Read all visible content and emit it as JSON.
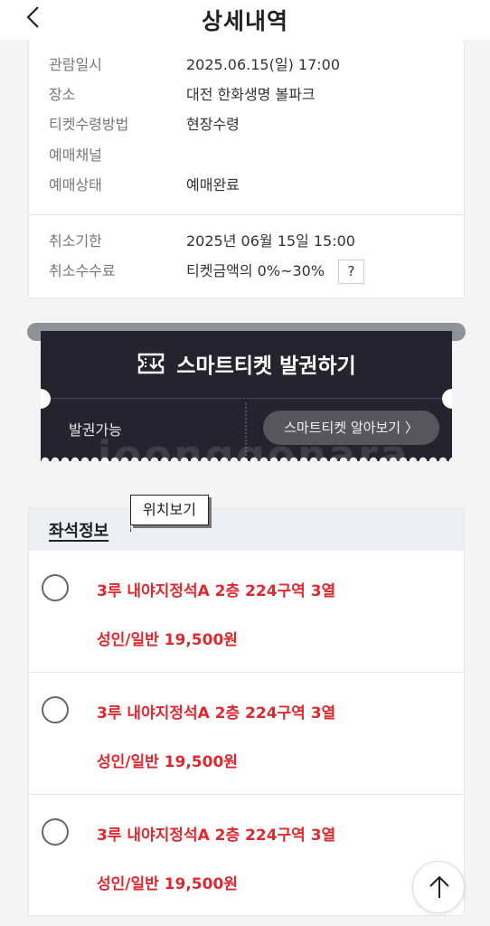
{
  "header": {
    "title": "상세내역"
  },
  "details": [
    {
      "label": "관람일시",
      "value": "2025.06.15(일) 17:00"
    },
    {
      "label": "장소",
      "value": "대전 한화생명 볼파크"
    },
    {
      "label": "티켓수령방법",
      "value": "현장수령"
    },
    {
      "label": "예매채널",
      "value": ""
    },
    {
      "label": "예매상태",
      "value": "예매완료"
    }
  ],
  "cancel": [
    {
      "label": "취소기한",
      "value": "2025년 06월 15일 15:00"
    },
    {
      "label": "취소수수료",
      "value": "티켓금액의 0%~30%"
    }
  ],
  "help_label": "?",
  "ticket": {
    "issue_label": "스마트티켓 발권하기",
    "status": "발권가능",
    "learn_label": "스마트티켓 알아보기 〉"
  },
  "watermark": "joonggonara",
  "seat_section": {
    "title": "좌석정보",
    "tooltip": "위치보기",
    "seats": [
      {
        "info": "3루 내야지정석A 2층 224구역 3열",
        "price": "성인/일반 19,500원"
      },
      {
        "info": "3루 내야지정석A 2층 224구역 3열",
        "price": "성인/일반 19,500원"
      },
      {
        "info": "3루 내야지정석A 2층 224구역 3열",
        "price": "성인/일반 19,500원"
      }
    ]
  },
  "colors": {
    "accent_red": "#e0282e",
    "ticket_dark": "#25232d",
    "ticket_button": "#57565d"
  }
}
